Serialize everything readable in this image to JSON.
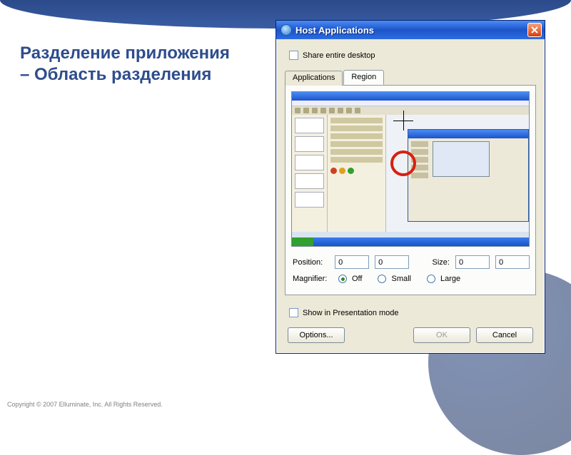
{
  "slide": {
    "title_line1": "Разделение приложения",
    "title_line2": "– Область разделения",
    "copyright": "Copyright © 2007 Elluminate, Inc. All Rights Reserved."
  },
  "dialog": {
    "title": "Host Applications",
    "share_entire_label": "Share entire desktop",
    "tabs": {
      "applications": "Applications",
      "region": "Region"
    },
    "position_label": "Position:",
    "position_x": "0",
    "position_y": "0",
    "size_label": "Size:",
    "size_w": "0",
    "size_h": "0",
    "magnifier_label": "Magnifier:",
    "magnifier_options": {
      "off": "Off",
      "small": "Small",
      "large": "Large"
    },
    "show_presentation_label": "Show in Presentation mode",
    "buttons": {
      "options": "Options...",
      "ok": "OK",
      "cancel": "Cancel"
    }
  }
}
